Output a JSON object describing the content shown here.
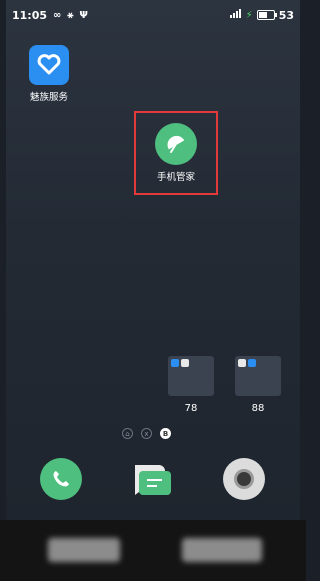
{
  "status_bar": {
    "time": "11:05",
    "left_icons": [
      "infinity-icon",
      "usb-network-icon",
      "usb-icon"
    ],
    "signal": "signal-icon",
    "battery_level": "53"
  },
  "apps": {
    "meizu_service": {
      "label": "魅族服务",
      "icon": "heart-shield-icon",
      "color": "#2b8ef1"
    },
    "phone_manager": {
      "label": "手机管家",
      "icon": "umbrella-icon",
      "color": "#4fbf7f"
    }
  },
  "folders": [
    {
      "count": "78"
    },
    {
      "count": "88"
    }
  ],
  "page_indicator": {
    "pages": [
      "home",
      "x",
      "B"
    ],
    "active": "B"
  },
  "dock": [
    {
      "name": "phone",
      "icon": "phone-icon"
    },
    {
      "name": "messages",
      "icon": "message-icon"
    },
    {
      "name": "camera",
      "icon": "camera-icon"
    }
  ],
  "highlight_color": "#e23a3a"
}
